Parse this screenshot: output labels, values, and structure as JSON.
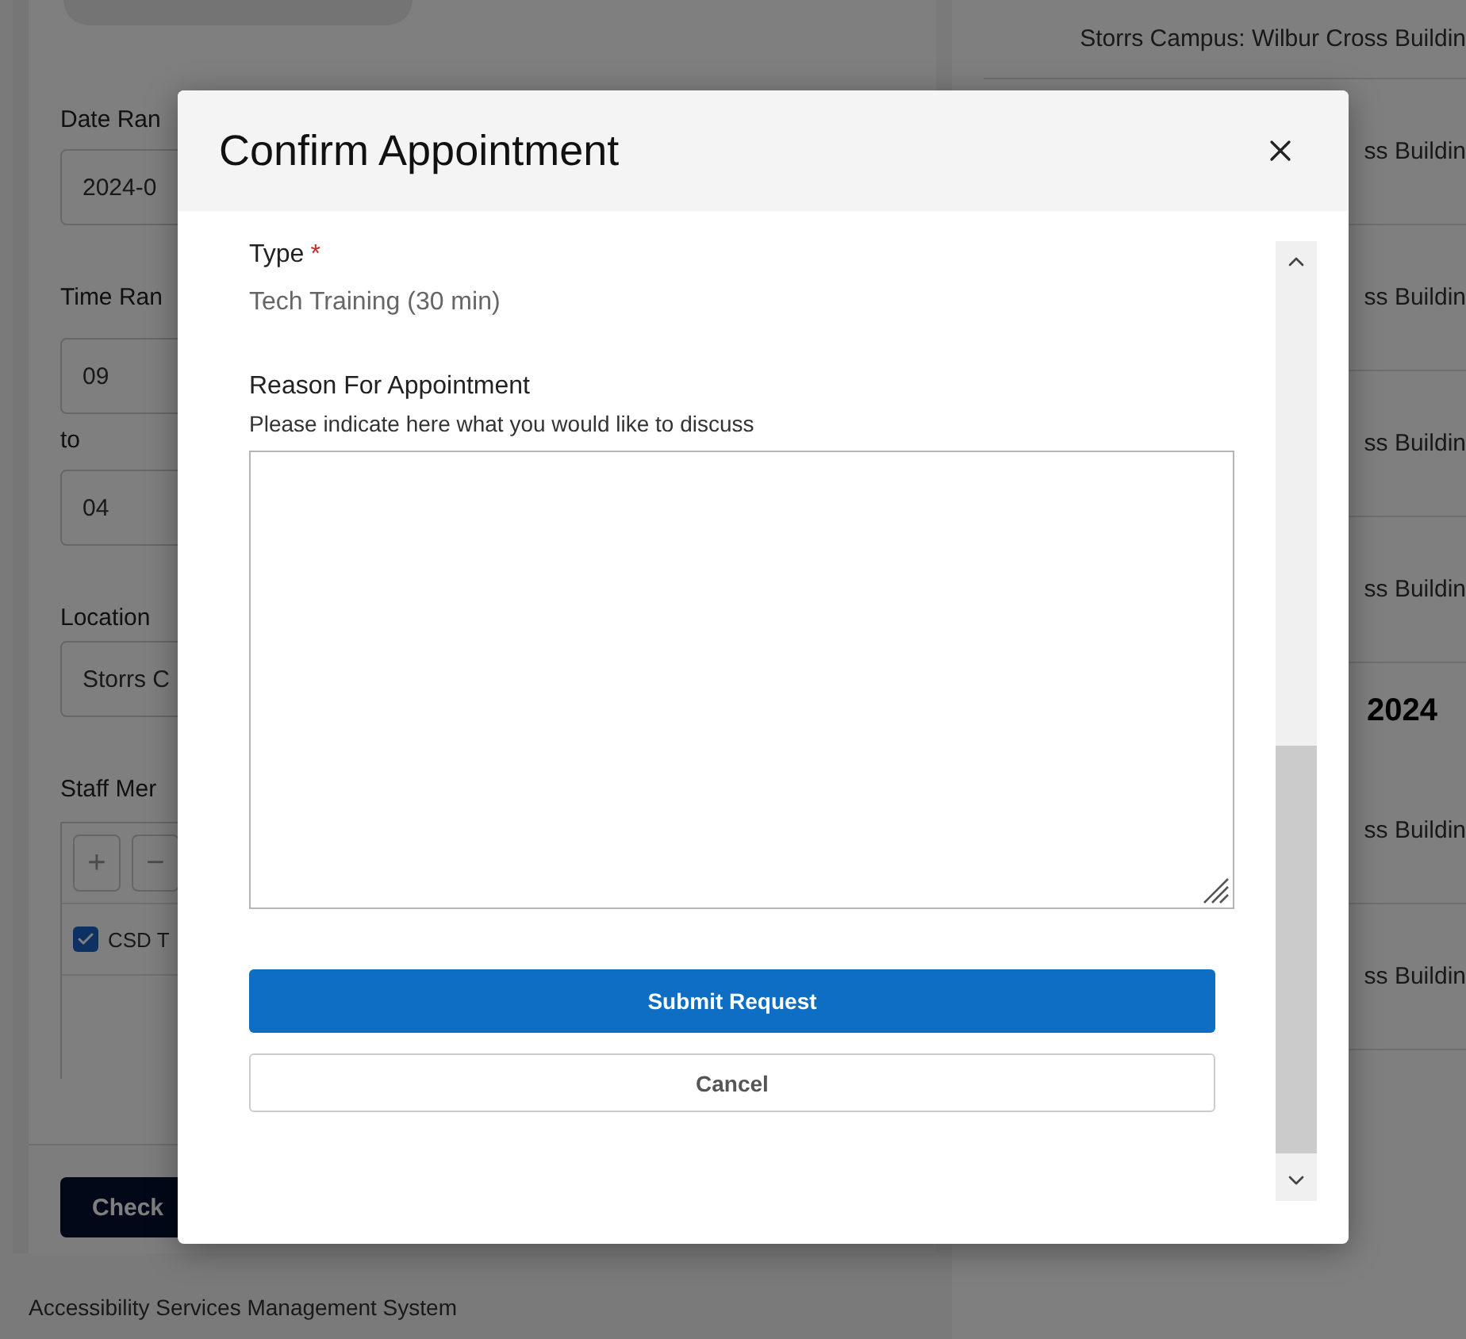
{
  "filters": {
    "date_label": "Date Ran",
    "date_value": "2024-0",
    "time_label": "Time Ran",
    "time_from": "09",
    "to_label": "to",
    "time_to": "04",
    "location_label": "Location",
    "location_value": "Storrs C",
    "staff_label": "Staff Mer",
    "toolbar": [
      "+",
      "−"
    ],
    "staff_items": [
      {
        "label": "CSD T",
        "checked": true
      }
    ],
    "button": "Check"
  },
  "results": [
    {
      "kind": "row",
      "text": "Storrs Campus: Wilbur Cross Buildin"
    },
    {
      "kind": "row",
      "text": "ss Buildin"
    },
    {
      "kind": "row",
      "text": "ss Buildin"
    },
    {
      "kind": "row",
      "text": "ss Buildin"
    },
    {
      "kind": "row",
      "text": "ss Buildin"
    },
    {
      "kind": "heading",
      "text": "2024"
    },
    {
      "kind": "row",
      "text": "ss Buildin"
    },
    {
      "kind": "row",
      "text": "ss Buildin"
    }
  ],
  "footer": "Accessibility Services Management System",
  "dialog": {
    "title": "Confirm Appointment",
    "fields": [
      {
        "kind": "static",
        "label": "Type",
        "required_mark": "*",
        "value": "Tech Training (30 min)"
      },
      {
        "kind": "textarea",
        "label": "Reason For Appointment",
        "hint": "Please indicate here what you would like to discuss"
      }
    ],
    "buttons": [
      {
        "kind": "primary",
        "label": "Submit Request"
      },
      {
        "kind": "secondary",
        "label": "Cancel"
      }
    ]
  }
}
